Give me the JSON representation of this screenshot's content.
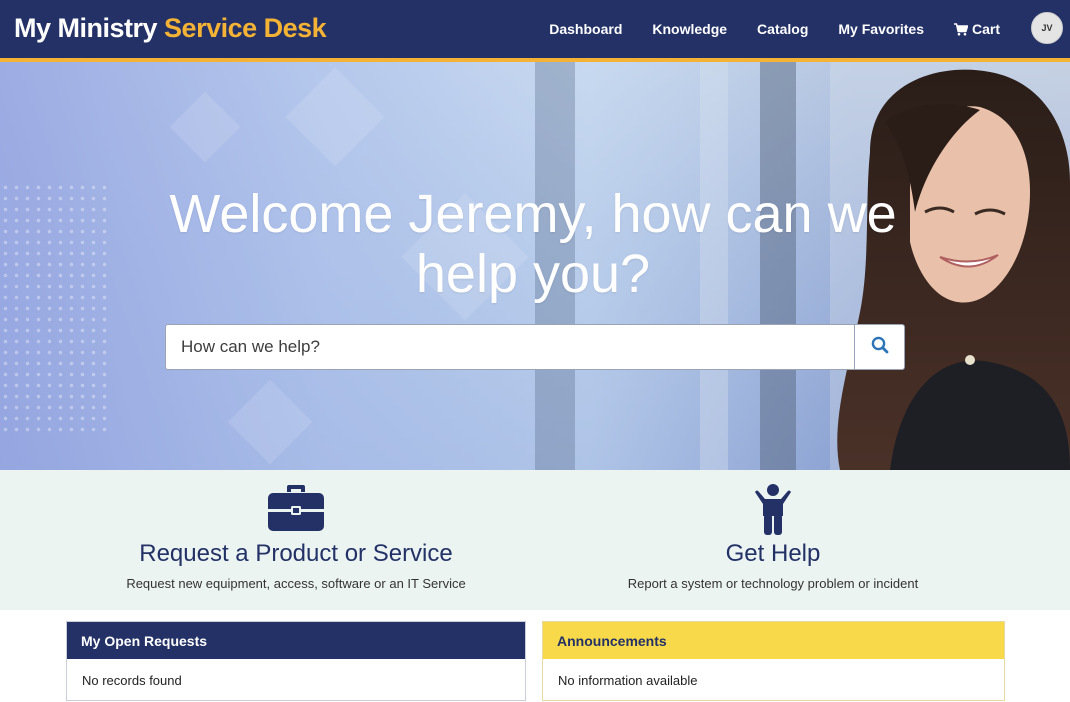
{
  "header": {
    "brand_part1": "My Ministry",
    "brand_part2": "Service Desk",
    "nav": [
      "Dashboard",
      "Knowledge",
      "Catalog",
      "My Favorites",
      "Cart"
    ],
    "avatar_initials": "JV",
    "colors": {
      "header_bg": "#233166",
      "accent": "#f5b335"
    }
  },
  "hero": {
    "title": "Welcome Jeremy, how can we help you?",
    "search_placeholder": "How can we help?",
    "search_icon": "search-icon"
  },
  "actions": [
    {
      "icon": "briefcase-icon",
      "title": "Request a Product or Service",
      "description": "Request new equipment, access, software or an IT Service"
    },
    {
      "icon": "person-arms-up-icon",
      "title": "Get Help",
      "description": "Report a system or technology problem or incident"
    }
  ],
  "widgets": {
    "open_requests": {
      "title": "My Open Requests",
      "body": "No records found"
    },
    "announcements": {
      "title": "Announcements",
      "body": "No information available"
    }
  }
}
